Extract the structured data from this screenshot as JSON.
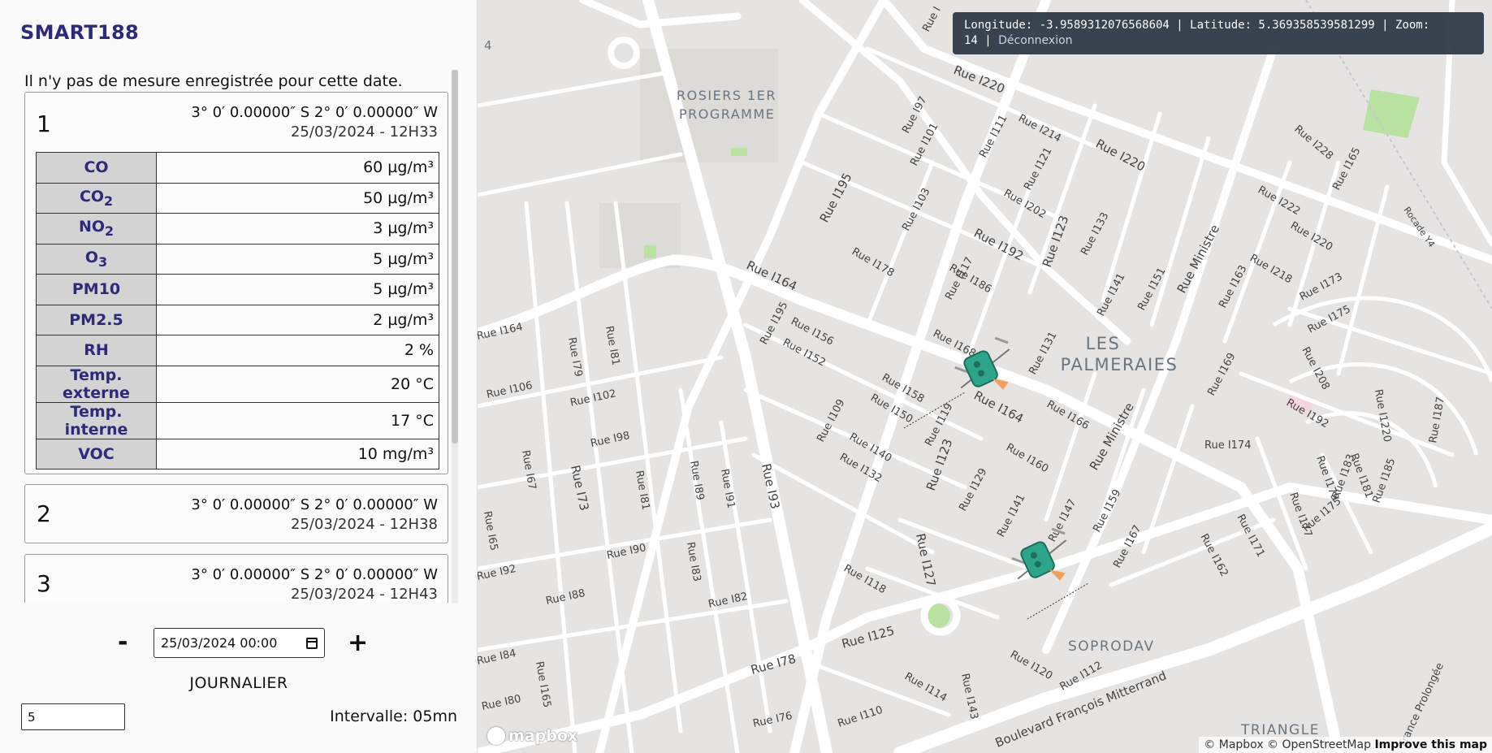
{
  "app": {
    "title": "SMART188"
  },
  "sidebar": {
    "no_data_message": "Il n'y pas de mesure enregistrée pour cette date.",
    "cards": [
      {
        "number": "1",
        "coords": "3° 0′ 0.00000″ S 2° 0′ 0.00000″ W",
        "datetime": "25/03/2024 - 12H33",
        "measures": [
          {
            "key": "CO",
            "sub": "",
            "value": "60 µg/m³"
          },
          {
            "key": "CO",
            "sub": "2",
            "value": "50 µg/m³"
          },
          {
            "key": "NO",
            "sub": "2",
            "value": "3 µg/m³"
          },
          {
            "key": "O",
            "sub": "3",
            "value": "5 µg/m³"
          },
          {
            "key": "PM10",
            "sub": "",
            "value": "5 µg/m³"
          },
          {
            "key": "PM2.5",
            "sub": "",
            "value": "2 µg/m³"
          },
          {
            "key": "RH",
            "sub": "",
            "value": "2 %"
          },
          {
            "key": "Temp. externe",
            "sub": "",
            "value": "20 °C"
          },
          {
            "key": "Temp. interne",
            "sub": "",
            "value": "17 °C"
          },
          {
            "key": "VOC",
            "sub": "",
            "value": "10 mg/m³"
          }
        ]
      },
      {
        "number": "2",
        "coords": "3° 0′ 0.00000″ S 2° 0′ 0.00000″ W",
        "datetime": "25/03/2024 - 12H38"
      },
      {
        "number": "3",
        "coords": "3° 0′ 0.00000″ S 2° 0′ 0.00000″ W",
        "datetime": "25/03/2024 - 12H43"
      }
    ],
    "controls": {
      "minus_label": "-",
      "plus_label": "+",
      "date_value": "25/03/2024 00:00",
      "mode_label": "JOURNALIER",
      "interval_value": "5",
      "interval_text": "Intervalle: 05mn"
    }
  },
  "map": {
    "coord_line": "Longitude: -3.9589312076568604 | Latitude: 5.369358539581299 | Zoom:",
    "zoom_value": "14",
    "logout_label": "Déconnexion",
    "attribution": "© Mapbox © OpenStreetMap",
    "improve_label": "Improve this map",
    "logo_text": "mapbox",
    "districts": {
      "rosiers_1": "ROSIERS 1ER",
      "rosiers_2": "PROGRAMME",
      "palmeraies_1": "LES",
      "palmeraies_2": "PALMERAIES",
      "soprodav": "SOPRODAV",
      "triangle": "TRIANGLE"
    },
    "road_labels": {
      "r1": "Rue I220",
      "r2": "Rue I220",
      "r3": "Rue I214",
      "r4": "Rue I228",
      "r5": "Rue I195",
      "r6": "Rue I192",
      "r7": "Rue I123",
      "r8": "Rue I164",
      "r9": "Rue I164",
      "r10": "Rue I164",
      "r11": "Rue Ministre",
      "r12": "Rue Ministre",
      "r13": "Rue I123",
      "r14": "Rue I127",
      "r15": "Rue I125",
      "r16": "Rue I78",
      "r17": "Rue I93",
      "r18": "Rue I73",
      "r19": "Boulevard François Mitterrand",
      "r20": "Rue I143",
      "r21": "Rue I187",
      "r22": "Rue I174",
      "r23": "Rocade Y4",
      "r24": "France Prolongée",
      "r25": "Rue I65",
      "r26": "Rue I106",
      "r27": "Rue I102",
      "r28": "Rue I98",
      "r29": "Rue I90",
      "r30": "Rue I88",
      "r31": "Rue I82",
      "r32": "Rue I76",
      "r33": "Rue I110",
      "r34": "Rue I114",
      "r35": "Rue I118",
      "r36": "Rue I120",
      "r37": "Rue I112",
      "r38": "Rue I158",
      "r39": "Rue I150",
      "r40": "Rue I140",
      "r41": "Rue I132",
      "r42": "Rue I166",
      "r43": "Rue I160",
      "r44": "Rue I178",
      "r45": "Rue I186",
      "r46": "Rue I202",
      "r47": "Rue I173",
      "r48": "Rue I175",
      "r49": "Rue I192",
      "r50": "Rue I218",
      "r51": "Rue I222",
      "r52": "Rue I92",
      "r53": "Rue I84",
      "r54": "Rue I80",
      "r55": "Rue I169",
      "r56": "Rue I162",
      "r57": "Rue I171",
      "r58": "Rue I147",
      "r59": "Rue I159",
      "r60": "Rue I167",
      "r61": "Rue I141",
      "r62": "Rue I129",
      "r63": "Rue I119",
      "r64": "Rue I109",
      "r65": "Rue I131",
      "r66": "Rue I168",
      "r67": "Rue I156",
      "r68": "Rue I152",
      "r69": "Rue I195",
      "r70": "Rue I79",
      "r71": "Rue I81",
      "r72": "Rue I67",
      "r73": "Rue I81",
      "r74": "Rue I89",
      "r75": "Rue I91",
      "r76": "Rue I83",
      "r77": "Rue I165",
      "r78": "Rue I103",
      "r79": "Rue I101",
      "r80": "Rue I97",
      "r81": "Rue I111",
      "r82": "Rue I121",
      "r83": "Rue I133",
      "r84": "Rue I141",
      "r85": "Rue I151",
      "r86": "Rue I163",
      "r87": "Rue I165",
      "r88": "Rue I208",
      "r89": "Rue I220",
      "r90": "Rue I181",
      "r91": "Rue I179",
      "r92": "Rue I177",
      "r93": "Rue I183",
      "r94": "Rue I185",
      "r95": "Rue I175",
      "r96": "Rue I117",
      "r97": "Rue I1220",
      "r98": "Rue I"
    },
    "marker_count": 2,
    "map_label_4": "4"
  }
}
